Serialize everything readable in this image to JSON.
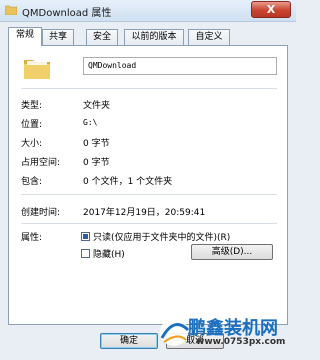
{
  "window": {
    "title": "QMDownload 属性",
    "close_glyph": "X"
  },
  "tabs": [
    {
      "label": "常规",
      "active": true
    },
    {
      "label": "共享",
      "active": false
    },
    {
      "label": "安全",
      "active": false
    },
    {
      "label": "以前的版本",
      "active": false
    },
    {
      "label": "自定义",
      "active": false
    }
  ],
  "general": {
    "folder_icon": "folder-icon",
    "name_value": "QMDownload",
    "rows": [
      {
        "label": "类型:",
        "value": "文件夹"
      },
      {
        "label": "位置:",
        "value": "G:\\"
      },
      {
        "label": "大小:",
        "value": "0 字节"
      },
      {
        "label": "占用空间:",
        "value": "0 字节"
      },
      {
        "label": "包含:",
        "value": "0 个文件，1 个文件夹"
      }
    ],
    "created_label": "创建时间:",
    "created_value": "2017年12月19日，20:59:41",
    "attributes_label": "属性:",
    "readonly_label": "只读(仅应用于文件夹中的文件)(R)",
    "readonly_checked": true,
    "hidden_label": "隐藏(H)",
    "hidden_checked": false,
    "advanced_button": "高级(D)..."
  },
  "buttons": {
    "ok": "确定",
    "cancel": "取消"
  },
  "watermark": {
    "brand": "鹏鑫装机网",
    "url": "www.0753px.com"
  },
  "colors": {
    "accent": "#1a6fc0",
    "close": "#c8442f",
    "folder": "#e8c45a"
  }
}
